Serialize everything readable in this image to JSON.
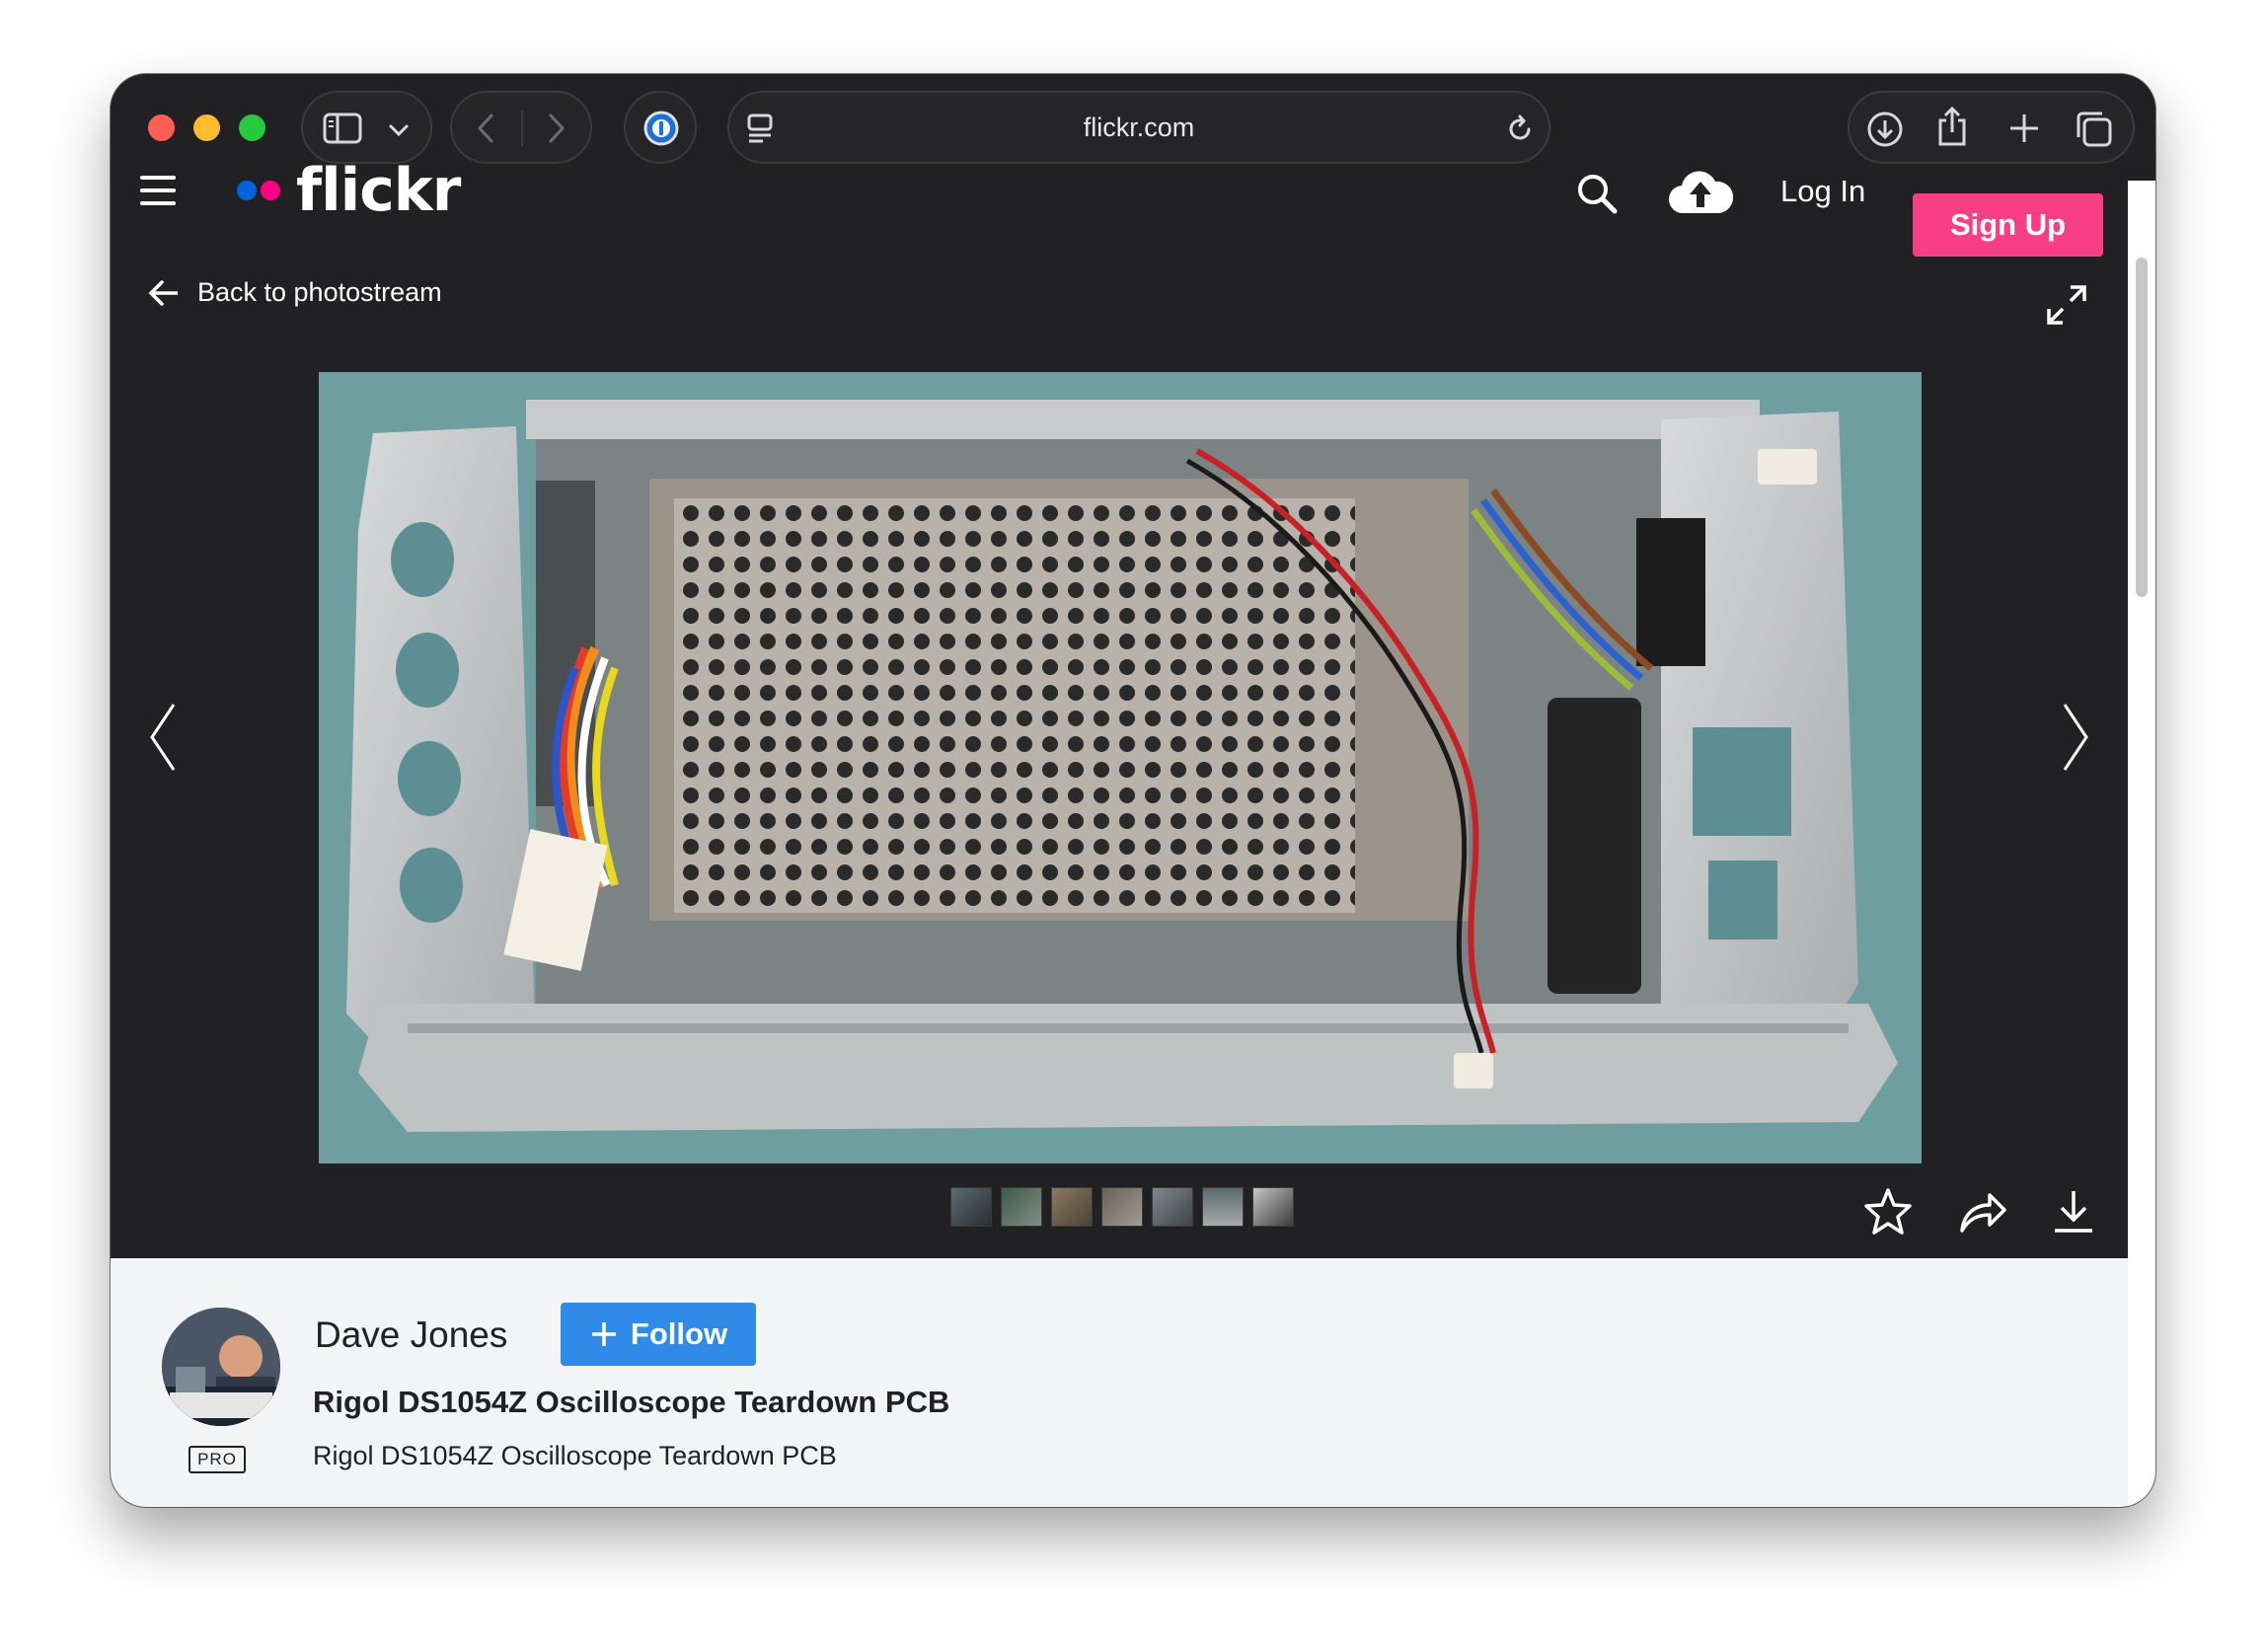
{
  "browser": {
    "url": "flickr.com"
  },
  "header": {
    "logo_text": "flickr",
    "login_label": "Log In",
    "signup_label": "Sign Up"
  },
  "viewer": {
    "back_label": "Back to photostream",
    "thumbnail_count": 7
  },
  "photo_info": {
    "author": "Dave Jones",
    "badge": "PRO",
    "follow_label": "Follow",
    "title": "Rigol DS1054Z Oscilloscope Teardown PCB",
    "description": "Rigol DS1054Z Oscilloscope Teardown PCB"
  },
  "colors": {
    "page_bg": "#212124",
    "brand_blue": "#0063dc",
    "brand_pink": "#ff0084",
    "signup_bg": "#f83f84",
    "follow_bg": "#308ae8",
    "info_bg": "#f3f4f6"
  },
  "icons": [
    "sidebar-icon",
    "chevron-down-icon",
    "back-arrow-icon",
    "forward-arrow-icon",
    "password-manager-icon",
    "tab-page-icon",
    "reload-icon",
    "download-icon",
    "share-icon",
    "new-tab-icon",
    "tabs-overview-icon",
    "menu-icon",
    "search-icon",
    "upload-cloud-icon",
    "arrow-left-icon",
    "expand-icon",
    "star-icon",
    "share-arrow-icon",
    "download-arrow-icon",
    "plus-icon"
  ]
}
